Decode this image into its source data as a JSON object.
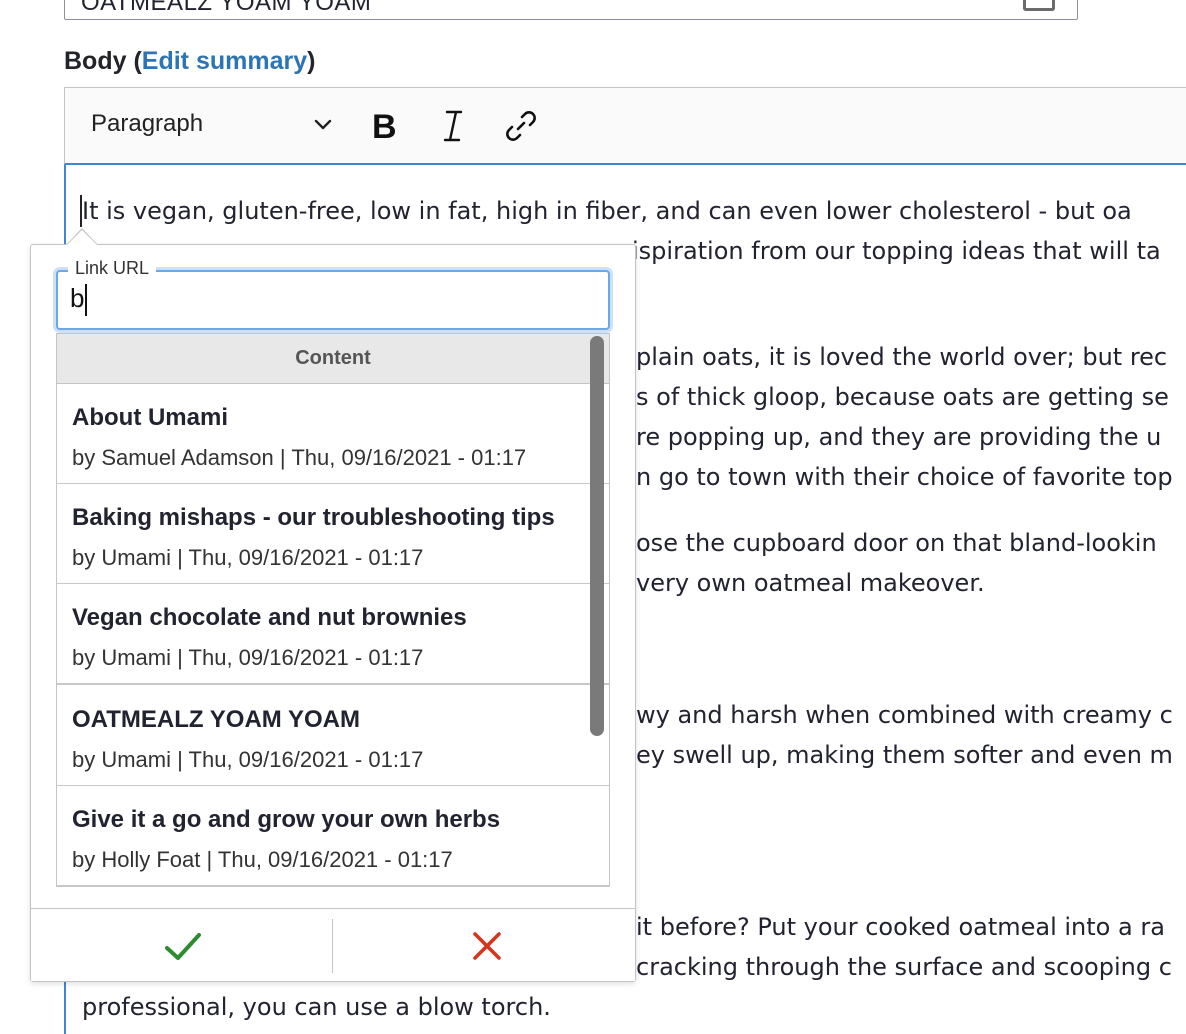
{
  "title_field": {
    "value": "OATMEALZ YOAM YOAM"
  },
  "body_label": {
    "label": "Body",
    "open_paren": "(",
    "link": "Edit summary",
    "close_paren": ")"
  },
  "toolbar": {
    "format": "Paragraph"
  },
  "editor": {
    "lines": [
      "It is vegan, gluten-free, low in fat, high in fiber, and can even lower cholesterol - but oa",
      "ispiration from our topping ideas that will ta",
      "plain oats, it is loved the world over; but rec",
      "s of thick gloop, because oats are getting se",
      "re popping up, and they are providing the u",
      "n go to town with their choice of favorite top",
      "ose the cupboard door on that bland-lookin",
      "very own oatmeal makeover.",
      "wy and harsh when combined with creamy c",
      "ey swell up, making them softer and even m",
      "it before? Put your cooked oatmeal into a ra",
      "cracking through the surface and scooping c",
      "professional, you can use a blow torch."
    ]
  },
  "link_balloon": {
    "url_label": "Link URL",
    "url_value": "b",
    "results_header": "Content",
    "results": [
      {
        "title": "About Umami",
        "meta": "by Samuel Adamson | Thu, 09/16/2021 - 01:17"
      },
      {
        "title": "Baking mishaps - our troubleshooting tips",
        "meta": "by Umami | Thu, 09/16/2021 - 01:17"
      },
      {
        "title": "Vegan chocolate and nut brownies",
        "meta": "by Umami | Thu, 09/16/2021 - 01:17"
      },
      {
        "title": "OATMEALZ YOAM YOAM",
        "meta": "by Umami | Thu, 09/16/2021 - 01:17"
      },
      {
        "title": "Give it a go and grow your own herbs",
        "meta": "by Holly Foat | Thu, 09/16/2021 - 01:17"
      }
    ]
  },
  "colors": {
    "accent": "#3f86d6",
    "link": "#2c74b3",
    "save": "#2e8b2e",
    "cancel": "#d4351c"
  },
  "icons": [
    "chevron-down-icon",
    "bold-icon",
    "italic-icon",
    "link-icon",
    "checkmark-icon",
    "close-icon",
    "card-icon"
  ]
}
